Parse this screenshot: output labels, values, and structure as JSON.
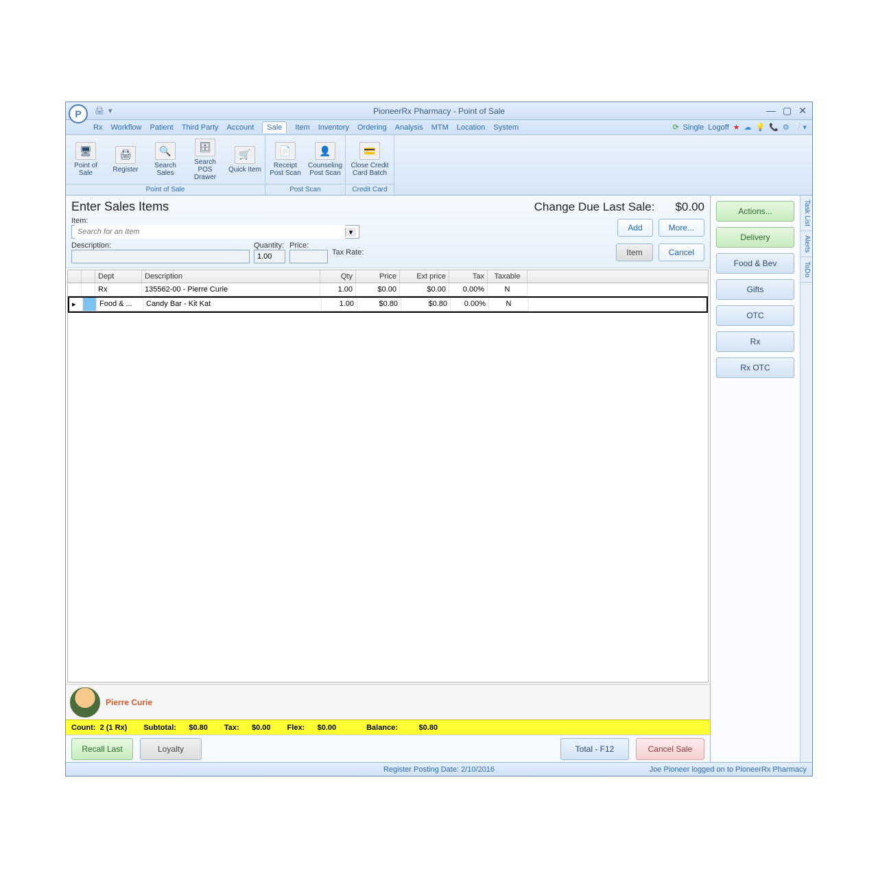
{
  "window": {
    "title": "PioneerRx Pharmacy - Point of Sale"
  },
  "menu": [
    "Rx",
    "Workflow",
    "Patient",
    "Third Party",
    "Account",
    "Sale",
    "Item",
    "Inventory",
    "Ordering",
    "Analysis",
    "MTM",
    "Location",
    "System"
  ],
  "menu_selected": "Sale",
  "menu_right": {
    "single": "Single",
    "logoff": "Logoff"
  },
  "ribbon": {
    "groups": [
      {
        "label": "Point of Sale",
        "items": [
          {
            "label": "Point of Sale",
            "icon": "🖥"
          },
          {
            "label": "Register",
            "icon": "🖨"
          },
          {
            "label": "Search Sales",
            "icon": "🔍"
          },
          {
            "label": "Search POS Drawer",
            "icon": "🗄"
          },
          {
            "label": "Quick Item",
            "icon": "🛒"
          }
        ]
      },
      {
        "label": "Post Scan",
        "items": [
          {
            "label": "Receipt Post Scan",
            "icon": "📄"
          },
          {
            "label": "Counseling Post Scan",
            "icon": "👤"
          }
        ]
      },
      {
        "label": "Credit Card",
        "items": [
          {
            "label": "Close Credit Card Batch",
            "icon": "💳"
          }
        ]
      }
    ]
  },
  "header": {
    "title": "Enter Sales Items",
    "change_label": "Change Due Last Sale:",
    "change_value": "$0.00",
    "item_label": "Item:",
    "search_placeholder": "Search for an Item",
    "desc_label": "Description:",
    "qty_label": "Quantity:",
    "qty_value": "1.00",
    "price_label": "Price:",
    "tax_label": "Tax Rate:",
    "btn_add": "Add",
    "btn_more": "More...",
    "btn_item": "Item",
    "btn_cancel": "Cancel"
  },
  "table": {
    "columns": [
      "",
      "",
      "Dept",
      "Description",
      "Qty",
      "Price",
      "Ext price",
      "Tax",
      "Taxable"
    ],
    "rows": [
      {
        "dept": "Rx",
        "desc": "135562-00 - Pierre Curie",
        "qty": "1.00",
        "price": "$0.00",
        "ext": "$0.00",
        "tax": "0.00%",
        "taxable": "N"
      },
      {
        "dept": "Food & ...",
        "desc": "Candy Bar - Kit Kat",
        "qty": "1.00",
        "price": "$0.80",
        "ext": "$0.80",
        "tax": "0.00%",
        "taxable": "N"
      }
    ]
  },
  "customer": {
    "name": "Pierre Curie"
  },
  "summary": {
    "count_label": "Count:",
    "count": "2 (1 Rx)",
    "subtotal_label": "Subtotal:",
    "subtotal": "$0.80",
    "tax_label": "Tax:",
    "tax": "$0.00",
    "flex_label": "Flex:",
    "flex": "$0.00",
    "balance_label": "Balance:",
    "balance": "$0.80"
  },
  "footer": {
    "recall": "Recall Last",
    "loyalty": "Loyalty",
    "total": "Total - F12",
    "cancel": "Cancel Sale"
  },
  "side": [
    "Actions...",
    "Delivery",
    "Food & Bev",
    "Gifts",
    "OTC",
    "Rx",
    "Rx OTC"
  ],
  "vtabs": [
    "Task List",
    "Alerts",
    "ToDo"
  ],
  "status": {
    "posting": "Register Posting Date: 2/10/2016",
    "logged": "Joe Pioneer logged on to PioneerRx Pharmacy"
  }
}
